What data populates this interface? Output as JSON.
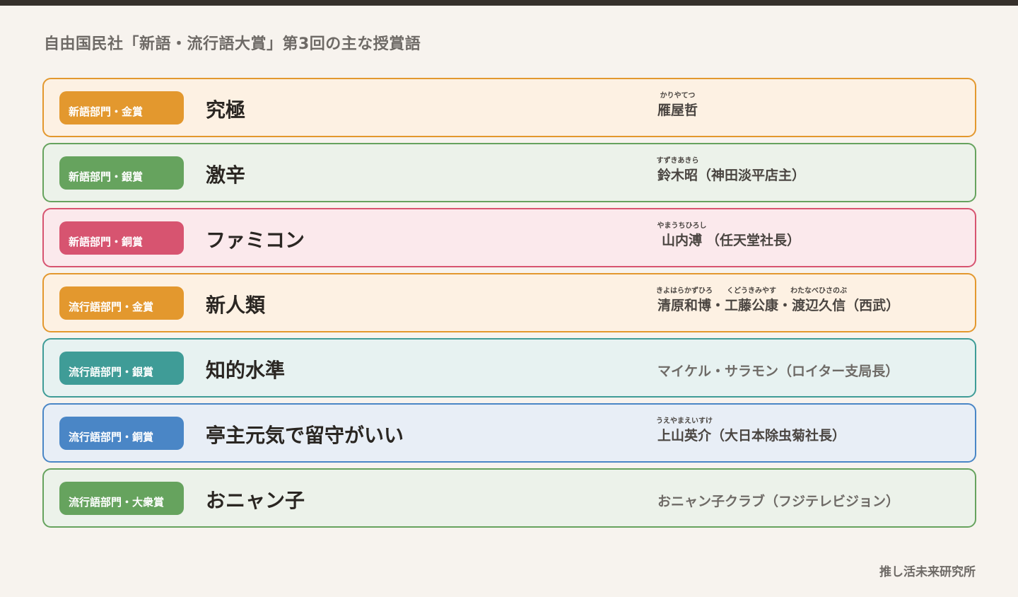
{
  "page": {
    "title": "自由国民社「新語・流行語大賞」第3回の主な授賞語",
    "footer": "推し活未来研究所"
  },
  "colors": {
    "orange": "#e3982e",
    "green": "#66a35e",
    "pink": "#d75470",
    "teal": "#3f9c97",
    "blue": "#4a86c6"
  },
  "rows": [
    {
      "category": "新語部門・金賞",
      "word": "究極",
      "winner": {
        "names": [
          {
            "ruby": "かりやてつ",
            "text": "雁屋哲"
          }
        ],
        "affiliation": ""
      }
    },
    {
      "category": "新語部門・銀賞",
      "word": "激辛",
      "winner": {
        "names": [
          {
            "ruby": "すずきあきら",
            "text": "鈴木昭"
          }
        ],
        "affiliation": "（神田淡平店主）"
      }
    },
    {
      "category": "新語部門・銅賞",
      "word": "ファミコン",
      "winner": {
        "names": [
          {
            "ruby": "やまうちひろし",
            "text": "山内溥"
          }
        ],
        "affiliation": "（任天堂社長）"
      }
    },
    {
      "category": "流行語部門・金賞",
      "word": "新人類",
      "winner": {
        "names": [
          {
            "ruby": "きよはらかずひろ",
            "text": "清原和博"
          },
          {
            "ruby": "くどうきみやす",
            "text": "工藤公康"
          },
          {
            "ruby": "わたなべひさのぶ",
            "text": "渡辺久信"
          }
        ],
        "separator": "・",
        "affiliation": "（西武）"
      }
    },
    {
      "category": "流行語部門・銀賞",
      "word": "知的水準",
      "winner": {
        "plain": "マイケル・サラモン（ロイター支局長）"
      }
    },
    {
      "category": "流行語部門・銅賞",
      "word": "亭主元気で留守がいい",
      "winner": {
        "names": [
          {
            "ruby": "うえやまえいすけ",
            "text": "上山英介"
          }
        ],
        "affiliation": "（大日本除虫菊社長）"
      }
    },
    {
      "category": "流行語部門・大衆賞",
      "word": "おニャン子",
      "winner": {
        "plain": "おニャン子クラブ（フジテレビジョン）"
      }
    }
  ]
}
